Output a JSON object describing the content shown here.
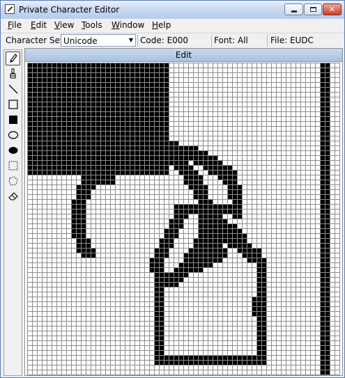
{
  "window": {
    "title": "Private Character Editor",
    "title_icon": "pencil-icon"
  },
  "menubar": {
    "items": [
      {
        "key": "F",
        "rest": "ile"
      },
      {
        "key": "E",
        "rest": "dit"
      },
      {
        "key": "V",
        "rest": "iew"
      },
      {
        "key": "T",
        "rest": "ools"
      },
      {
        "key": "W",
        "rest": "indow"
      },
      {
        "key": "H",
        "rest": "elp"
      }
    ]
  },
  "infobar": {
    "charset_label": "Character Set:",
    "charset_value": "Unicode",
    "code": "Code: E000",
    "font": "Font: All",
    "file": "File: EUDC"
  },
  "toolbox": {
    "tools": [
      {
        "name": "pencil-icon",
        "active": true
      },
      {
        "name": "brush-icon"
      },
      {
        "name": "line-icon"
      },
      {
        "name": "hollow-rectangle-icon"
      },
      {
        "name": "filled-rectangle-icon"
      },
      {
        "name": "hollow-ellipse-icon"
      },
      {
        "name": "filled-ellipse-icon"
      },
      {
        "name": "rectangular-selection-icon"
      },
      {
        "name": "freeform-selection-icon"
      },
      {
        "name": "eraser-icon"
      }
    ]
  },
  "edit": {
    "title": "Edit",
    "grid_columns": 64,
    "grid_rows": 64,
    "colors": {
      "ink": "#000000",
      "paper": "#ffffff",
      "gridline": "#8c8c8c"
    }
  }
}
